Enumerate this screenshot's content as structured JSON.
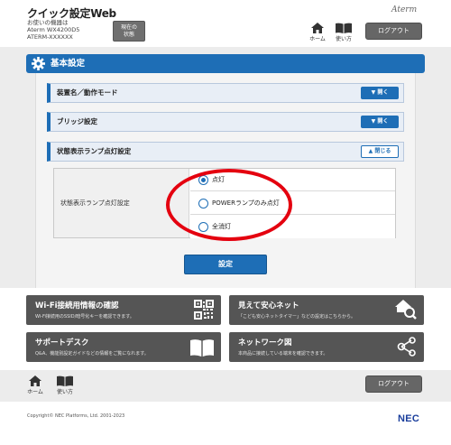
{
  "header": {
    "app_title": "クイック設定Web",
    "device_caption": "お使いの機器は",
    "device_model": "Aterm WX4200D5",
    "device_id": "ATERM-XXXXXX",
    "status_button": [
      "現在の",
      "状態"
    ],
    "brand": "Aterm",
    "home_label": "ホーム",
    "manual_label": "使い方",
    "logout_label": "ログアウト"
  },
  "section": {
    "title": "基本設定",
    "accordions": [
      {
        "label": "装置名／動作モード",
        "button": "開く",
        "expanded": false
      },
      {
        "label": "ブリッジ設定",
        "button": "開く",
        "expanded": false
      },
      {
        "label": "状態表示ランプ点灯設定",
        "button": "閉じる",
        "expanded": true
      }
    ],
    "setting_label": "状態表示ランプ点灯設定",
    "options": [
      {
        "label": "点灯",
        "selected": true
      },
      {
        "label": "POWERランプのみ点灯",
        "selected": false
      },
      {
        "label": "全消灯",
        "selected": false
      }
    ],
    "apply_label": "設定"
  },
  "tiles": [
    {
      "title": "Wi-Fi接続用情報の確認",
      "desc": "Wi-Fi接続用のSSID/暗号化キーを確認できます。",
      "icon": "qr-code-icon"
    },
    {
      "title": "見えて安心ネット",
      "desc": "「こども安心ネットタイマー」などの設定はこちらから。",
      "icon": "home-search-icon"
    },
    {
      "title": "サポートデスク",
      "desc": "Q&A、機能別設定ガイドなどの情報をご覧になれます。",
      "icon": "book-icon"
    },
    {
      "title": "ネットワーク図",
      "desc": "本商品に接続している端末を確認できます。",
      "icon": "network-icon"
    }
  ],
  "footer": {
    "home_label": "ホーム",
    "manual_label": "使い方",
    "logout_label": "ログアウト",
    "copyright": "Copyright© NEC Platforms, Ltd. 2001-2023",
    "nec_logo": "NEC"
  },
  "colors": {
    "accent": "#1e6eb6",
    "tile": "#555555",
    "highlight": "#e4000f",
    "background": "#ececec"
  }
}
